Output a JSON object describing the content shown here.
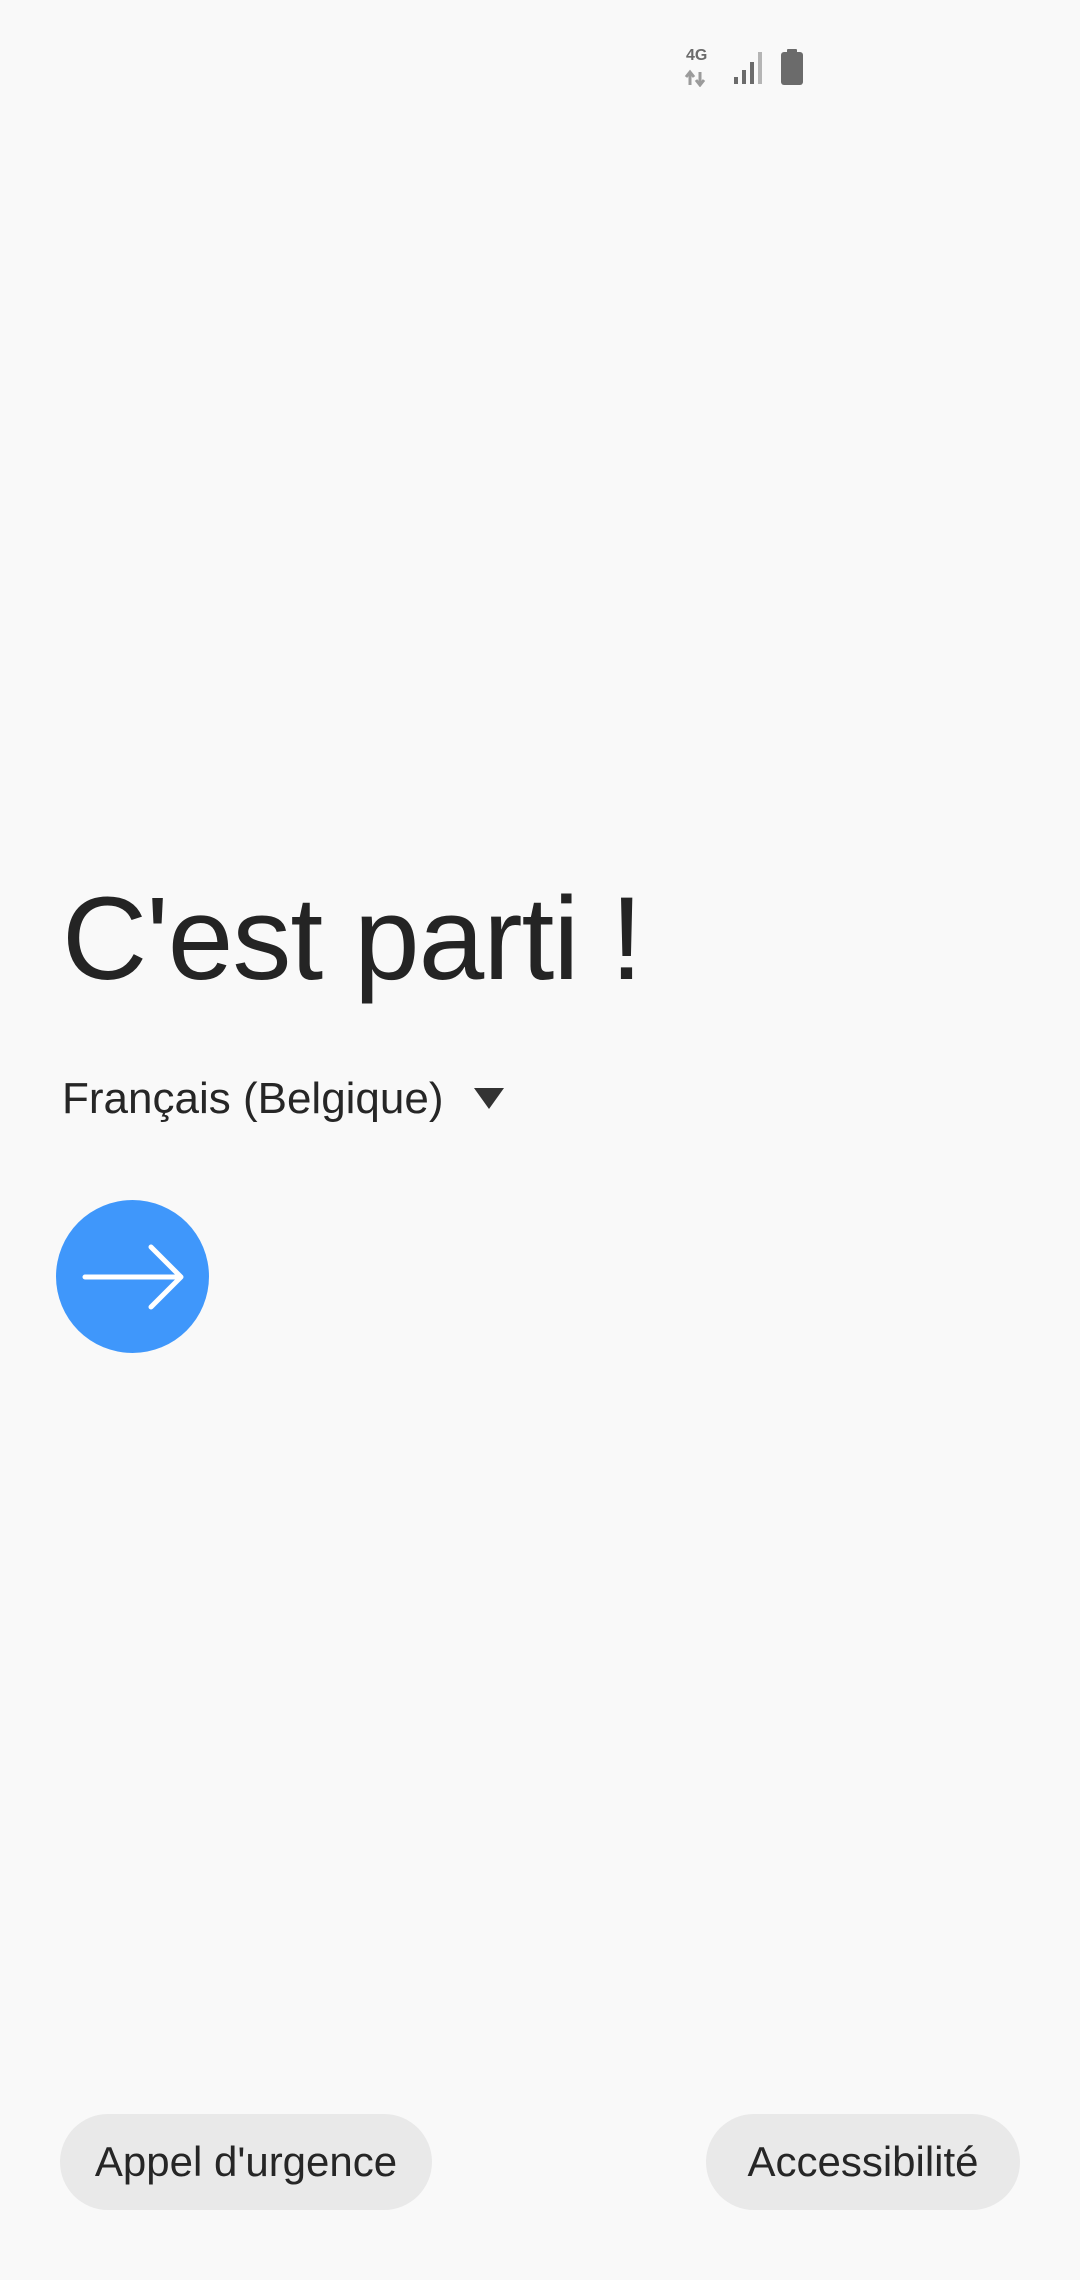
{
  "status_bar": {
    "network_type": "4G",
    "icons": [
      "network-4g-icon",
      "signal-icon",
      "battery-icon"
    ]
  },
  "welcome": {
    "title": "C'est parti !",
    "language": {
      "selected": "Français (Belgique)",
      "dropdown_icon": "caret-down-icon"
    },
    "next_icon": "arrow-right-icon"
  },
  "footer": {
    "emergency_call_label": "Appel d'urgence",
    "accessibility_label": "Accessibilité"
  },
  "colors": {
    "background": "#f9f9f9",
    "accent": "#3f97fb",
    "pill_background": "#e9e9e9",
    "text": "#242424"
  }
}
